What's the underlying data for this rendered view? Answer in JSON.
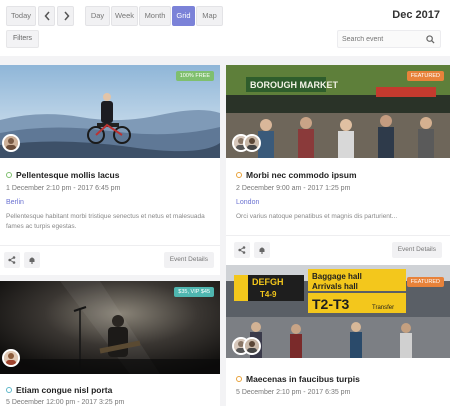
{
  "toolbar": {
    "today_label": "Today",
    "prev_icon": "chevron-left-icon",
    "next_icon": "chevron-right-icon",
    "views": [
      "Day",
      "Week",
      "Month",
      "Grid",
      "Map"
    ],
    "active_view": "Grid",
    "month_title": "Dec 2017",
    "filters_label": "Filters",
    "search_placeholder": "Search event",
    "accent_color": "#7b82d8"
  },
  "events": [
    {
      "title": "Pellentesque mollis lacus",
      "badge": "100% FREE",
      "badge_color": "#7fbf6e",
      "dot_color": "#7fbf6e",
      "date": "1 December 2:10 pm - 2017 6:45 pm",
      "location": "Berlin",
      "description": "Pellentesque habitant morbi tristique senectus et netus et malesuada fames ac turpis egestas.",
      "details_label": "Event Details"
    },
    {
      "title": "Morbi nec commodo ipsum",
      "badge": "FEATURED",
      "badge_color": "#e8823a",
      "dot_color": "#e8a23a",
      "date": "2 December 9:00 am - 2017 1:25 pm",
      "location": "London",
      "description": "Orci varius natoque penatibus et magnis dis parturient...",
      "details_label": "Event Details",
      "image_text": "BOROUGH MARKET"
    },
    {
      "title": "Etiam congue nisl porta",
      "badge": "$35, VIP $45",
      "badge_color": "#4fb6b0",
      "dot_color": "#5fb7c9",
      "date": "5 December 12:00 pm - 2017 3:25 pm"
    },
    {
      "title": "Maecenas in faucibus turpis",
      "badge": "FEATURED",
      "badge_color": "#e8823a",
      "dot_color": "#e8a23a",
      "date": "5 December 2:10 pm - 2017 6:35 pm",
      "image_signs": [
        "DEFGH",
        "T4-9",
        "Baggage hall",
        "Arrivals hall",
        "T2-T3",
        "Transfer"
      ]
    }
  ]
}
